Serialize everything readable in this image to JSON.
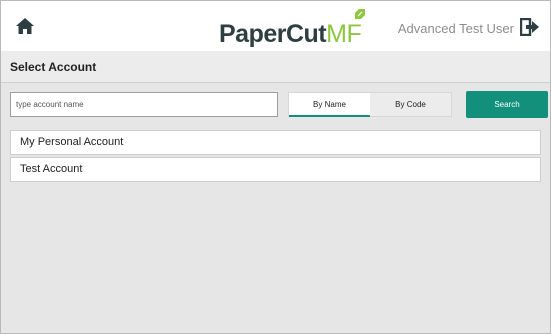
{
  "header": {
    "logo_part1": "PaperCut",
    "logo_part2": "MF",
    "user_name": "Advanced Test User",
    "icons": {
      "home": "home-icon",
      "logout": "logout-icon"
    },
    "brand_green": "#8ec63f",
    "brand_dark": "#2f3e40"
  },
  "page": {
    "title": "Select Account"
  },
  "search": {
    "placeholder": "type account name",
    "value": "",
    "button_label": "Search",
    "accent_color": "#12907b"
  },
  "mode_toggle": {
    "options": [
      "By Name",
      "By Code"
    ],
    "selected": "By Name"
  },
  "accounts": [
    {
      "name": "My Personal Account"
    },
    {
      "name": "Test Account"
    }
  ]
}
